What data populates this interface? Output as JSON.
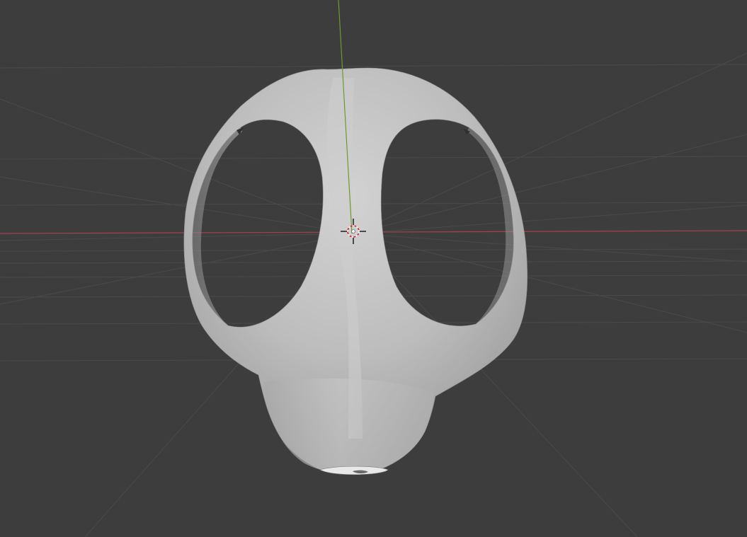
{
  "viewport": {
    "background": "#3d3d3d",
    "grid_color": "#4a4a4a",
    "x_axis_color": "#a3414f",
    "y_axis_color": "#6e9a2c",
    "mesh_color": "#bdbdbd",
    "cursor_icon": "3d-cursor-icon"
  }
}
